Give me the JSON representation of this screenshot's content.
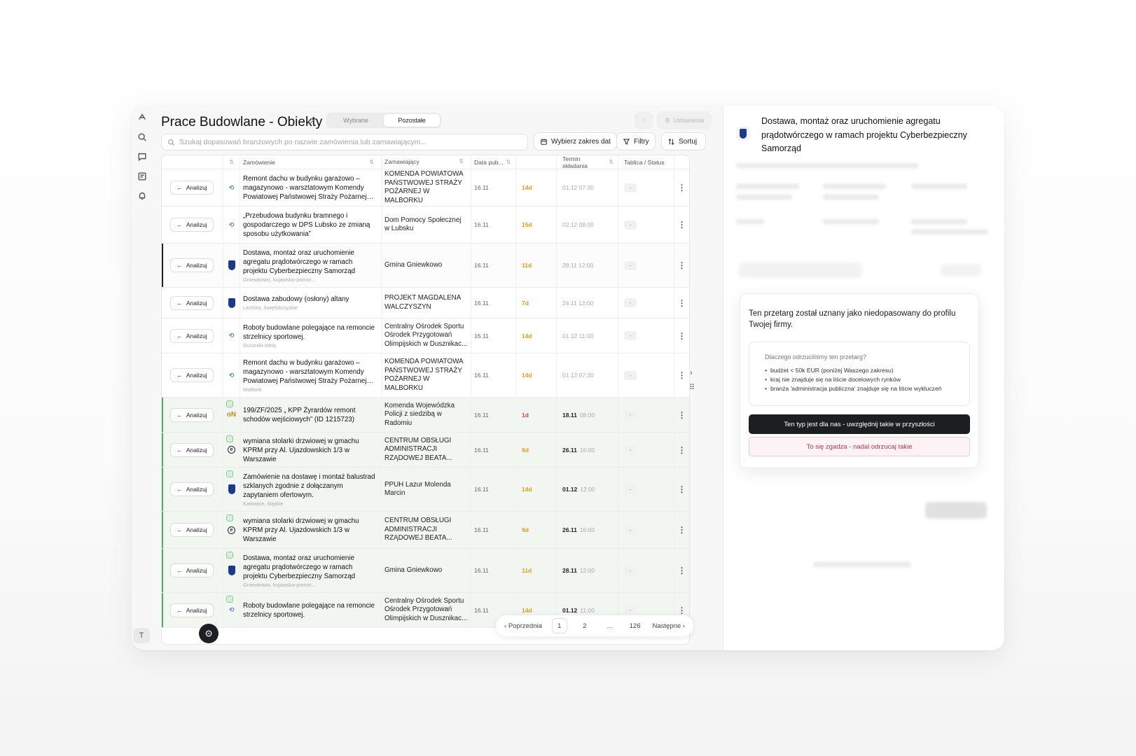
{
  "header": {
    "title": "Prace Budowlane - Obiekty",
    "tabs": [
      "Wybrane",
      "Pozostałe"
    ],
    "settings_label": "Ustawienia"
  },
  "search": {
    "placeholder": "Szukaj dopasowań branżowych po nazwie zamówienia lub zamawiającym..."
  },
  "toolbar": {
    "date_range": "Wybierz zakres dat",
    "filters": "Filtry",
    "sort": "Sortuj"
  },
  "table": {
    "columns": [
      "Zamówienie",
      "Zamawiający",
      "Data pub...",
      "Termin składania",
      "Tablica / Status"
    ],
    "analyze_label": "Analizuj",
    "rows": [
      {
        "title": "Remont dachu w budynku garażowo – magazynowo - warsztatowym Komendy Powiatowej Państwowej Straży Pożarnej w...",
        "loc": "",
        "buyer": "KOMENDA POWIATOWA PAŃSTWOWEJ STRAŻY POŻARNEJ W MALBORKU",
        "pub": "16.11",
        "days": "14d",
        "deadline": "01.12 07:30",
        "status": "-",
        "logo": "bird",
        "style": "",
        "strong": false
      },
      {
        "title": "„Przebudowa budynku bramnego i gospodarczego w DPS Lubsko ze zmianą sposobu użytkowania”",
        "loc": "",
        "buyer": "Dom Pomocy Społecznej w Lubsku",
        "pub": "16.11",
        "days": "15d",
        "deadline": "02.12 08:00",
        "status": "-",
        "logo": "bird",
        "style": "",
        "strong": false
      },
      {
        "title": "Dostawa, montaż oraz uruchomienie agregatu prądotwórczego w ramach projektu Cyberbezpieczny Samorząd",
        "loc": "Gniewkowo, kujawsko-pomor...",
        "buyer": "Gmina Gniewkowo",
        "pub": "16.11",
        "days": "11d",
        "deadline": "28.11 12:00",
        "status": "-",
        "logo": "shield",
        "style": "active",
        "strong": false
      },
      {
        "title": "Dostawa zabudowy (osłony) altany",
        "loc": "Lechów, świętokrzyskie",
        "buyer": "PROJEKT MAGDALENA WALCZYSZYN",
        "pub": "16.11",
        "days": "7d",
        "deadline": "24.11 12:00",
        "status": "-",
        "logo": "shield",
        "style": "",
        "strong": false
      },
      {
        "title": "Roboty budowlane polegające na remoncie strzelnicy sportowej.",
        "loc": "Duszniki-zdrój",
        "buyer": "Centralny Ośrodek Sportu Ośrodek Przygotowań Olimpijskich w Dusznikac...",
        "pub": "16.11",
        "days": "14d",
        "deadline": "01.12 11:00",
        "status": "-",
        "logo": "bird",
        "style": "",
        "strong": false
      },
      {
        "title": "Remont dachu w budynku garażowo – magazynowo - warsztatowym Komendy Powiatowej Państwowej Straży Pożarnej w...",
        "loc": "Malbork",
        "buyer": "KOMENDA POWIATOWA PAŃSTWOWEJ STRAŻY POŻARNEJ W MALBORKU",
        "pub": "16.11",
        "days": "14d",
        "deadline": "01.12 07:30",
        "status": "-",
        "logo": "bird",
        "style": "",
        "strong": false
      },
      {
        "title": "199/ZF/2025 „ KPP Żyrardów remont schodów wejściowych” (ID 1215723)",
        "loc": "",
        "buyer": "Komenda Wojewódzka Policji z siedzibą w Radomiu",
        "pub": "16.11",
        "days": "1d",
        "deadline_d": "18.11",
        "deadline_t": "08:00",
        "status": "-",
        "logo": "on",
        "style": "green",
        "strong": true
      },
      {
        "title": "wymiana stolarki drzwiowej w gmachu KPRM przy Al. Ujazdowskich 1/3 w Warszawie",
        "loc": "",
        "buyer": "CENTRUM OBSŁUGI ADMINISTRACJI RZĄDOWEJ BEATA...",
        "pub": "16.11",
        "days": "9d",
        "deadline_d": "26.11",
        "deadline_t": "16:00",
        "status": "-",
        "logo": "circ",
        "style": "green",
        "strong": true
      },
      {
        "title": "Zamówienie na dostawę i montaż balustrad szklanych zgodnie z dołączanym zapytaniem ofertowym.",
        "loc": "Katowice, śląskie",
        "buyer": "PPUH Lazur Molenda Marcin",
        "pub": "16.11",
        "days": "14d",
        "deadline_d": "01.12",
        "deadline_t": "12:00",
        "status": "-",
        "logo": "shield",
        "style": "green",
        "strong": true
      },
      {
        "title": "wymiana stolarki drzwiowej w gmachu KPRM przy Al. Ujazdowskich 1/3 w Warszawie",
        "loc": "",
        "buyer": "CENTRUM OBSŁUGI ADMINISTRACJI RZĄDOWEJ BEATA...",
        "pub": "16.11",
        "days": "9d",
        "deadline_d": "26.11",
        "deadline_t": "16:00",
        "status": "-",
        "logo": "circ",
        "style": "green",
        "strong": true
      },
      {
        "title": "Dostawa, montaż oraz uruchomienie agregatu prądotwórczego w ramach projektu Cyberbezpieczny Samorząd",
        "loc": "Gniewkowo, kujawsko-pomor...",
        "buyer": "Gmina Gniewkowo",
        "pub": "16.11",
        "days": "11d",
        "deadline_d": "28.11",
        "deadline_t": "12:00",
        "status": "-",
        "logo": "shield",
        "style": "green",
        "strong": true
      },
      {
        "title": "Roboty budowlane polegające na remoncie strzelnicy sportowej.",
        "loc": "",
        "buyer": "Centralny Ośrodek Sportu Ośrodek Przygotowań Olimpijskich w Dusznikac...",
        "pub": "16.11",
        "days": "14d",
        "deadline_d": "01.12",
        "deadline_t": "11:00",
        "status": "-",
        "logo": "bird",
        "style": "green",
        "strong": true
      }
    ]
  },
  "pagination": {
    "prev": "Poprzednia",
    "pages": [
      "1",
      "2",
      "...",
      "126"
    ],
    "next": "Następne"
  },
  "rail": {
    "avatar": "T"
  },
  "detail": {
    "title": "Dostawa, montaż oraz uruchomienie agregatu prądotwórczego w ramach projektu Cyberbezpieczny Samorząd"
  },
  "modal": {
    "heading": "Ten przetarg został uznany jako niedopasowany do profilu Twojej firmy.",
    "question": "Dlaczego odrzuciliśmy ten przetarg?",
    "reasons": [
      "budżet < 50k EUR (poniżej Waszego zakresu)",
      "kraj nie znajduje się na liście docelowych rynków",
      "branża 'administracja publiczna' znajduje się na liście wykluczeń"
    ],
    "accept": "Ten typ jest dla nas - uwzględnij takie w przyszłości",
    "reject": "To się zgadza - nadal odrzucaj takie"
  },
  "colors": {
    "accent_dark": "#1d1e22",
    "deadline_orange": "#e39a1f",
    "green_row": "#4caf6b",
    "reject_red": "#c0334b"
  }
}
